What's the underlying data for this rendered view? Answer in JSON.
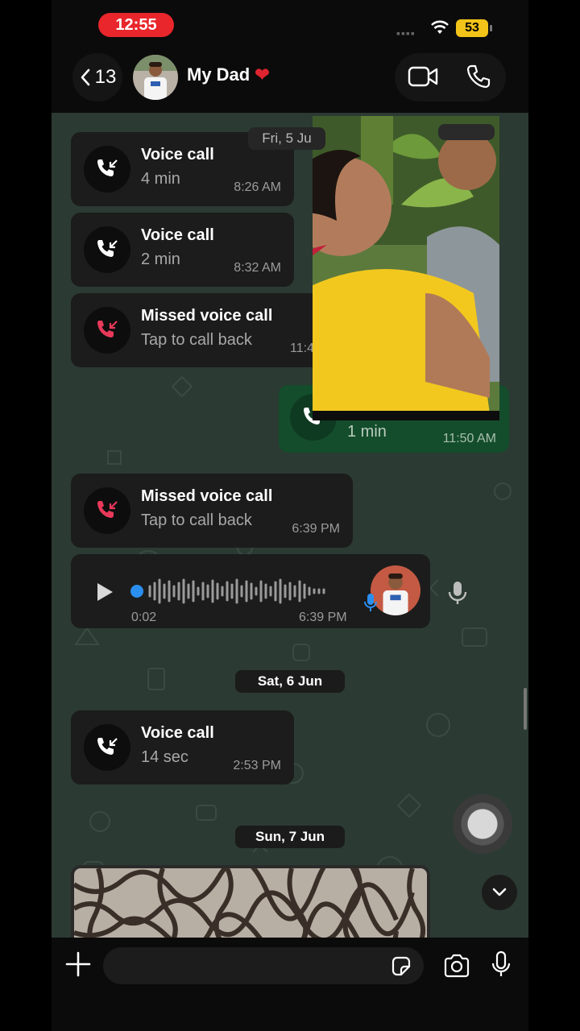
{
  "status_bar": {
    "time": "12:55",
    "battery": "53"
  },
  "header": {
    "back_count": "13",
    "title": "My Dad",
    "heart": "❤️"
  },
  "messages": [
    {
      "kind": "call",
      "direction": "incoming",
      "title": "Voice call",
      "subtitle": "4 min",
      "time": "8:26 AM",
      "status": "answered"
    },
    {
      "kind": "call",
      "direction": "incoming",
      "title": "Voice call",
      "subtitle": "2 min",
      "time": "8:32 AM",
      "status": "answered"
    },
    {
      "kind": "call",
      "direction": "incoming",
      "title": "Missed voice call",
      "subtitle": "Tap to call back",
      "time": "11:4",
      "status": "missed"
    },
    {
      "kind": "call",
      "direction": "outgoing",
      "subtitle": "1 min",
      "time": "11:50 AM"
    },
    {
      "kind": "call",
      "direction": "incoming",
      "title": "Missed voice call",
      "subtitle": "Tap to call back",
      "time": "6:39 PM",
      "status": "missed"
    },
    {
      "kind": "voice-note",
      "direction": "incoming",
      "duration": "0:02",
      "time": "6:39 PM"
    },
    {
      "kind": "call",
      "direction": "incoming",
      "title": "Voice call",
      "subtitle": "14 sec",
      "time": "2:53 PM",
      "status": "answered"
    },
    {
      "kind": "image",
      "direction": "incoming"
    }
  ],
  "date_separators": {
    "fri": "Fri, 5 Ju",
    "sat": "Sat, 6 Jun",
    "sun": "Sun, 7 Jun"
  },
  "input": {
    "placeholder": ""
  },
  "colors": {
    "missed": "#e8395a",
    "chat_background": "#2b3a33",
    "outgoing_bubble": "#144d2c",
    "incoming_bubble": "#1c1c1c",
    "status_time_pill": "#e8262b",
    "battery": "#f2c318"
  },
  "icons": [
    "chevron-left-icon",
    "video-camera-icon",
    "phone-icon",
    "incoming-call-arrow-icon",
    "missed-call-arrow-icon",
    "play-icon",
    "microphone-icon",
    "plus-icon",
    "sticker-icon",
    "camera-icon",
    "chevron-down-icon",
    "wifi-icon"
  ]
}
